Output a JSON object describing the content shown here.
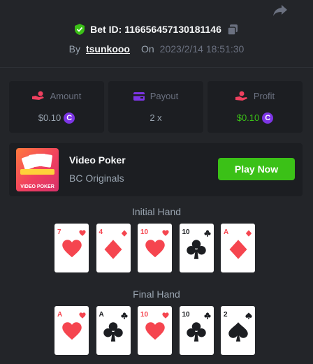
{
  "header": {
    "bet_label": "Bet ID:",
    "bet_id": "116656457130181146",
    "by_label": "By",
    "username": "tsunkooo",
    "on_label": "On",
    "datetime": "2023/2/14 18:51:30"
  },
  "stats": {
    "amount": {
      "label": "Amount",
      "value": "$0.10",
      "coin": "C"
    },
    "payout": {
      "label": "Payout",
      "value": "2 x"
    },
    "profit": {
      "label": "Profit",
      "value": "$0.10",
      "coin": "C"
    }
  },
  "game": {
    "title": "Video Poker",
    "provider": "BC Originals",
    "thumb_label": "VIDEO POKER",
    "play_label": "Play Now"
  },
  "initial_hand": {
    "title": "Initial Hand",
    "cards": [
      {
        "rank": "7",
        "suit": "heart"
      },
      {
        "rank": "4",
        "suit": "diamond"
      },
      {
        "rank": "10",
        "suit": "heart"
      },
      {
        "rank": "10",
        "suit": "club"
      },
      {
        "rank": "A",
        "suit": "diamond"
      }
    ]
  },
  "final_hand": {
    "title": "Final Hand",
    "cards": [
      {
        "rank": "A",
        "suit": "heart"
      },
      {
        "rank": "A",
        "suit": "club"
      },
      {
        "rank": "10",
        "suit": "heart"
      },
      {
        "rank": "10",
        "suit": "club"
      },
      {
        "rank": "2",
        "suit": "spade"
      }
    ]
  },
  "colors": {
    "background": "#232529",
    "panel": "#1c1e22",
    "accent_green": "#3bc117",
    "coin_purple": "#7d35e6",
    "red_suit": "#f5454f"
  },
  "icons": {
    "share": "share-icon",
    "shield": "shield-check-icon",
    "copy": "copy-icon",
    "amount": "hand-coin-icon",
    "payout": "wallet-icon",
    "profit": "profit-icon"
  }
}
